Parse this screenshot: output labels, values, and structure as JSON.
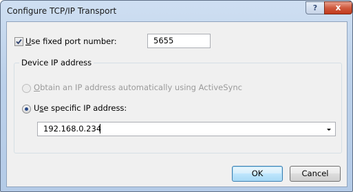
{
  "window": {
    "title": "Configure TCP/IP Transport",
    "help_glyph": "?",
    "close_glyph": "x"
  },
  "port": {
    "checkbox_checked": true,
    "label_mnemonic": "U",
    "label_rest": "se fixed port number:",
    "value": "5655"
  },
  "device_ip": {
    "group_title": "Device IP address",
    "option_auto": {
      "selected": false,
      "enabled": false,
      "mnemonic": "O",
      "rest": "btain an IP address automatically using ActiveSync"
    },
    "option_specific": {
      "selected": true,
      "pre": "U",
      "mnemonic": "s",
      "rest": "e specific IP address:"
    },
    "ip_value": "192.168.0.234"
  },
  "buttons": {
    "ok": "OK",
    "cancel": "Cancel"
  }
}
